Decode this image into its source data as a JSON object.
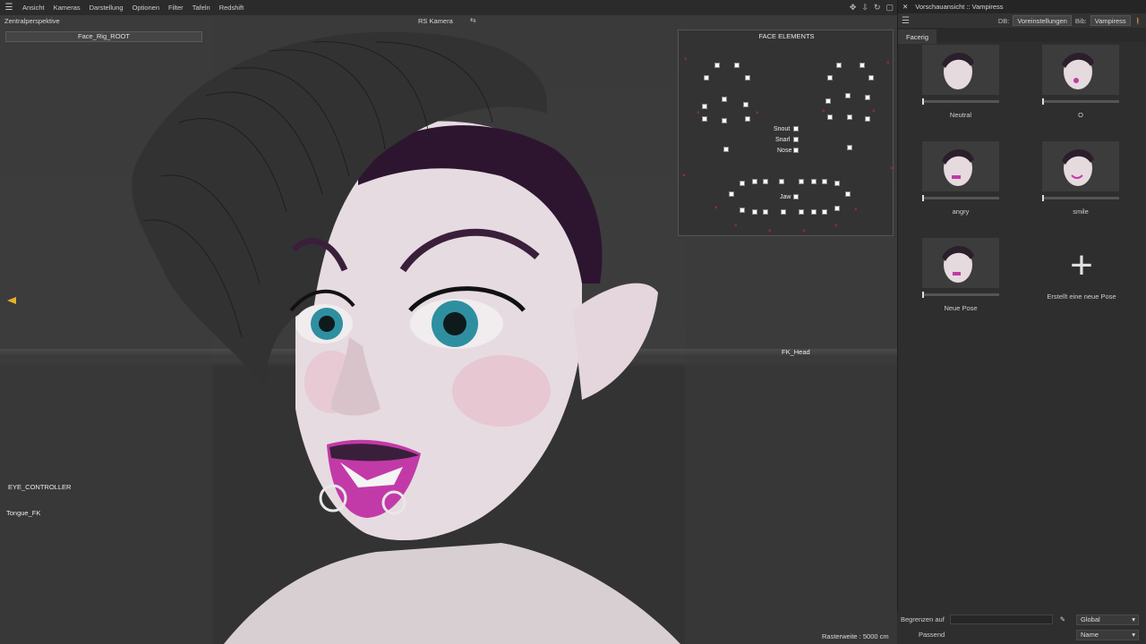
{
  "viewport": {
    "menu": [
      "Ansicht",
      "Kameras",
      "Darstellung",
      "Optionen",
      "Filter",
      "Tafeln",
      "Redshift"
    ],
    "camera_label": "Zentralperspektive",
    "rs_camera": "RS Kamera",
    "root_control": "Face_Rig_ROOT",
    "eye_controller": "EYE_CONTROLLER",
    "tongue": "Tongue_FK",
    "fk_head": "FK_Head",
    "raster": "Rasterweite : 5000 cm",
    "face_elements": {
      "title": "FACE ELEMENTS",
      "labels": {
        "snout": "Snout",
        "snarl": "Snarl",
        "nose": "Nose",
        "jaw": "Jaw"
      }
    }
  },
  "pose_panel": {
    "title": "Vorschauansicht :: Vampiress",
    "db_label": "DB:",
    "db_value": "Voreinstellungen",
    "lib_label": "Bib:",
    "lib_value": "Vampiress",
    "tab": "Facerig",
    "poses": [
      {
        "name": "Neutral"
      },
      {
        "name": "O"
      },
      {
        "name": "angry"
      },
      {
        "name": "smile"
      },
      {
        "name": "Neue Pose"
      }
    ],
    "new_pose_label": "Erstellt eine neue Pose",
    "limit_label": "Begrenzen auf",
    "scope_value": "Global",
    "match_label": "Passend",
    "sort_value": "Name"
  },
  "colors": {
    "accent": "#e8b12a",
    "skin": "#e6d9de",
    "lips": "#c23aa8",
    "eyes": "#2e8fa0",
    "hair": "#2a1f2a"
  }
}
